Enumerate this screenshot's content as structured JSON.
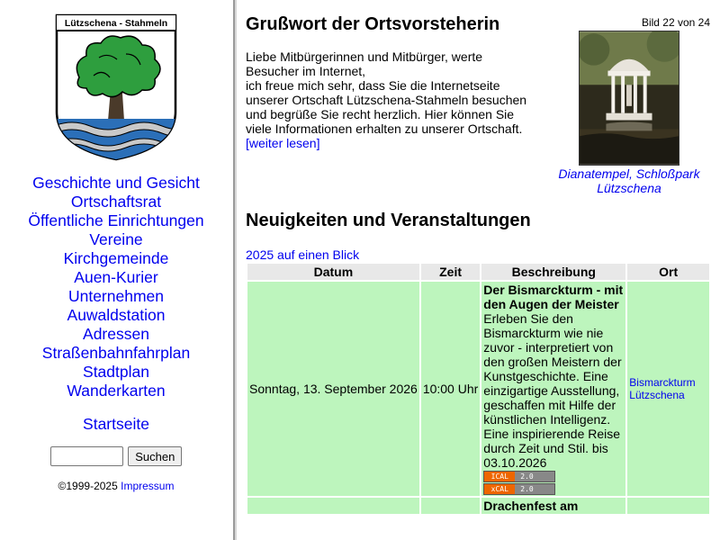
{
  "crest": {
    "banner": "Lützschena - Stahmeln"
  },
  "nav": {
    "items": [
      "Geschichte und Gesicht",
      "Ortschaftsrat",
      "Öffentliche Einrichtungen",
      "Vereine",
      "Kirchgemeinde",
      "Auen-Kurier",
      "Unternehmen",
      "Auwaldstation",
      "Adressen",
      "Straßenbahnfahrplan",
      "Stadtplan",
      "Wanderkarten"
    ],
    "home": "Startseite"
  },
  "search": {
    "value": "",
    "button": "Suchen"
  },
  "footer": {
    "copyright": "©1999-2025",
    "impressum": "Impressum"
  },
  "greeting": {
    "title": "Grußwort der Ortsvorsteherin",
    "paragraph": "Liebe Mitbürgerinnen und Mitbürger, werte Besucher im Internet,",
    "paragraph2": "ich freue mich sehr, dass Sie die Internetseite unserer Ortschaft Lützschena-Stahmeln besuchen und begrüße Sie recht herzlich. Hier können Sie viele Informationen erhalten zu unserer Ortschaft.",
    "more_link": "[weiter lesen]"
  },
  "photo": {
    "counter": "Bild 22 von 24",
    "caption": "Dianatempel, Schloßpark Lützschena"
  },
  "news": {
    "title": "Neuigkeiten und Veranstaltungen",
    "year_link": "2025 auf einen Blick",
    "headers": {
      "date": "Datum",
      "time": "Zeit",
      "desc": "Beschreibung",
      "place": "Ort"
    },
    "events": [
      {
        "date": "Sonntag, 13. September 2026",
        "time": "10:00 Uhr",
        "title": "Der Bismarckturm - mit den Augen der Meister",
        "description": "Erleben Sie den Bismarckturm wie nie zuvor - interpretiert von den großen Meistern der Kunstgeschichte. Eine einzigartige Ausstellung, geschaffen mit Hilfe der künstlichen Intelligenz. Eine inspirierende Reise durch Zeit und Stil. bis 03.10.2026",
        "badge1_left": "ICAL",
        "badge1_right": "2.0",
        "badge2_left": "xCAL",
        "badge2_right": "2.0",
        "place": "Bismarckturm Lützschena"
      },
      {
        "title": "Drachenfest am"
      }
    ]
  },
  "colors": {
    "link": "#0000ee",
    "event_row": "#bdf5bd",
    "header_row": "#e8e8e8",
    "crest_tree": "#2e9e3e",
    "crest_water": "#2b6fb8"
  }
}
